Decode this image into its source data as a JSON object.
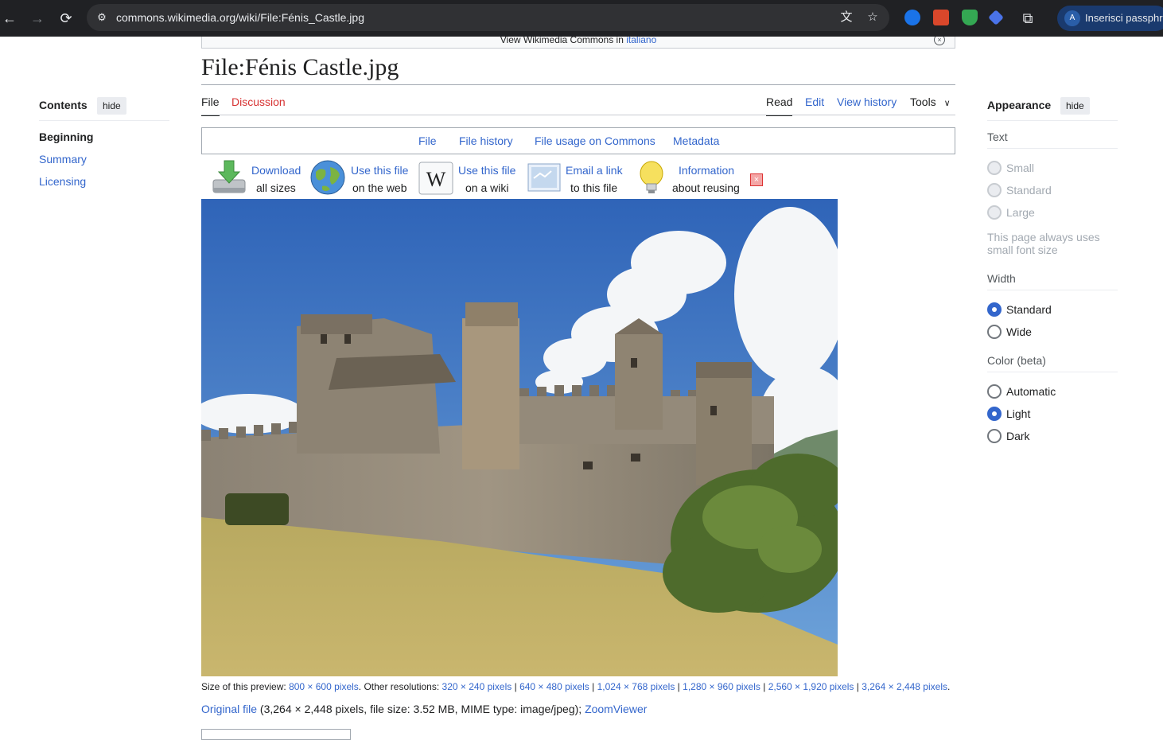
{
  "browser": {
    "url": "commons.wikimedia.org/wiki/File:Fénis_Castle.jpg",
    "profile_label": "Inserisci passphrase",
    "profile_initial": "A"
  },
  "banner": {
    "text": "View Wikimedia Commons in",
    "link": "italiano"
  },
  "page_title": "File:Fénis Castle.jpg",
  "toc": {
    "heading": "Contents",
    "hide_label": "hide",
    "items": [
      "Beginning",
      "Summary",
      "Licensing"
    ]
  },
  "tabs": {
    "left": [
      "File",
      "Discussion"
    ],
    "right": [
      "Read",
      "Edit",
      "View history",
      "Tools"
    ]
  },
  "subnav": [
    "File",
    "File history",
    "File usage on Commons",
    "Metadata"
  ],
  "actions": [
    {
      "line1": "Download",
      "line2": "all sizes",
      "icon": "download-icon"
    },
    {
      "line1": "Use this file",
      "line2": "on the web",
      "icon": "globe-icon"
    },
    {
      "line1": "Use this file",
      "line2": "on a wiki",
      "icon": "wikipedia-icon"
    },
    {
      "line1": "Email a link",
      "line2": "to this file",
      "icon": "email-icon"
    },
    {
      "line1": "Information",
      "line2": "about reusing",
      "icon": "lightbulb-icon"
    }
  ],
  "resolutions": {
    "preview_label": "Size of this preview:",
    "preview": "800 × 600 pixels",
    "other_label": ". Other resolutions:",
    "list": [
      "320 × 240 pixels",
      "640 × 480 pixels",
      "1,024 × 768 pixels",
      "1,280 × 960 pixels",
      "2,560 × 1,920 pixels",
      "3,264 × 2,448 pixels"
    ]
  },
  "original": {
    "link": "Original file",
    "details": "(3,264 × 2,448 pixels, file size: 3.52 MB, MIME type: image/jpeg);",
    "zoom": "ZoomViewer"
  },
  "appearance": {
    "heading": "Appearance",
    "hide_label": "hide",
    "text_heading": "Text",
    "text_options": [
      "Small",
      "Standard",
      "Large"
    ],
    "text_note": "This page always uses small font size",
    "width_heading": "Width",
    "width_options": [
      "Standard",
      "Wide"
    ],
    "width_selected": "Standard",
    "color_heading": "Color (beta)",
    "color_options": [
      "Automatic",
      "Light",
      "Dark"
    ],
    "color_selected": "Light"
  }
}
